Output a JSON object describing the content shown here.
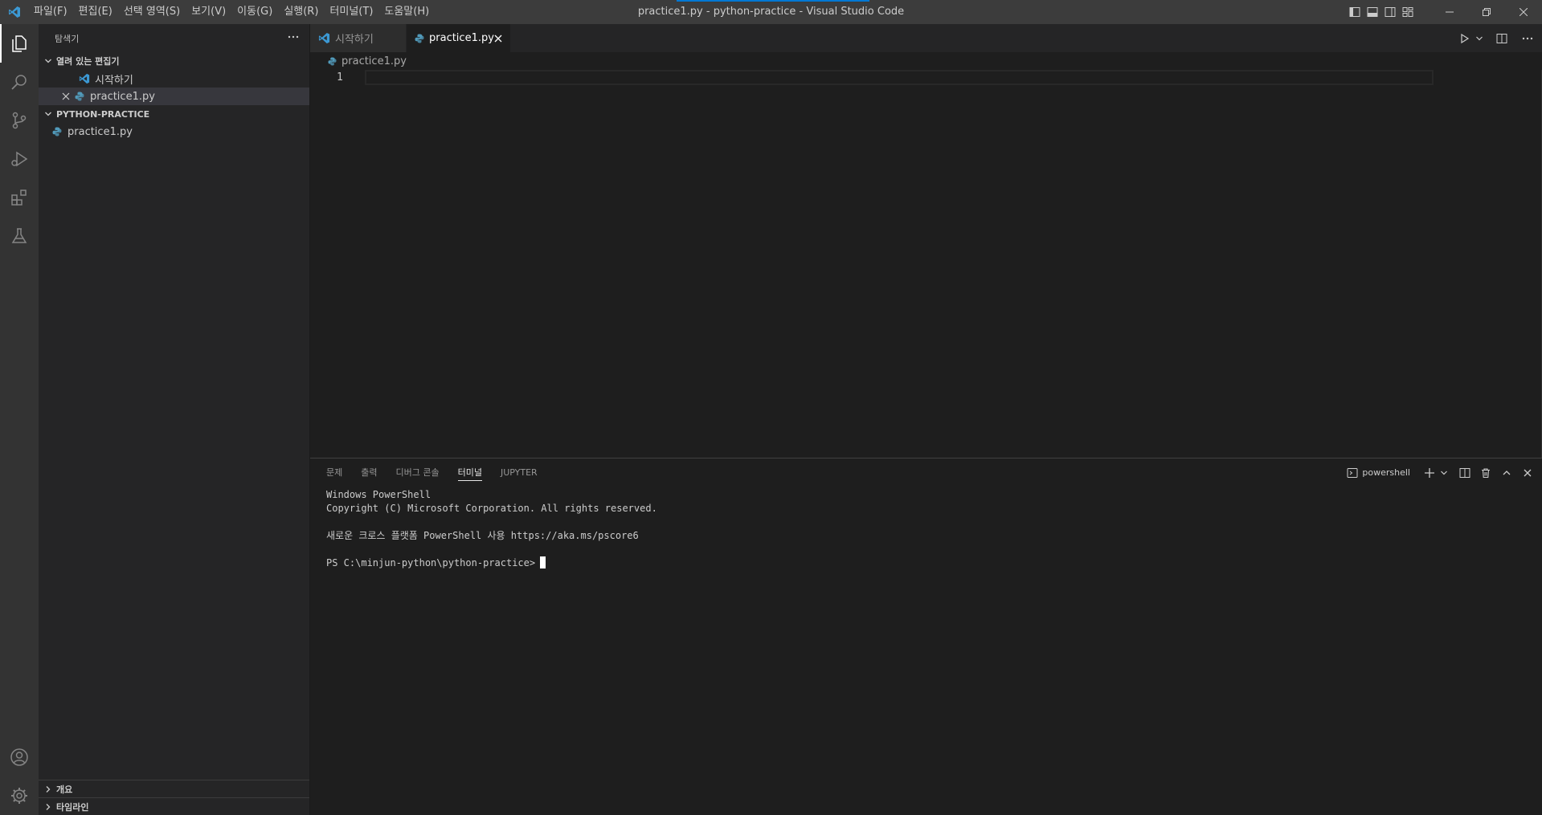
{
  "titlebar": {
    "window_title": "practice1.py - python-practice - Visual Studio Code",
    "menu": [
      "파일(F)",
      "편집(E)",
      "선택 영역(S)",
      "보기(V)",
      "이동(G)",
      "실행(R)",
      "터미널(T)",
      "도움말(H)"
    ]
  },
  "activitybar": {
    "items": [
      "files-icon",
      "search-icon",
      "source-control-icon",
      "run-debug-icon",
      "extensions-icon",
      "testing-icon"
    ],
    "bottom_items": [
      "account-icon",
      "settings-gear-icon"
    ]
  },
  "sidebar": {
    "title": "탐색기",
    "open_editors": {
      "label": "열려 있는 편집기",
      "items": [
        {
          "label": "시작하기",
          "icon": "vscode-icon"
        },
        {
          "label": "practice1.py",
          "icon": "python-icon"
        }
      ]
    },
    "folder": {
      "label": "PYTHON-PRACTICE",
      "files": [
        {
          "label": "practice1.py",
          "icon": "python-icon"
        }
      ]
    },
    "outline_label": "개요",
    "timeline_label": "타임라인"
  },
  "editor": {
    "tabs": [
      {
        "label": "시작하기",
        "active": false
      },
      {
        "label": "practice1.py",
        "active": true
      }
    ],
    "breadcrumb": "practice1.py",
    "line_numbers": [
      "1"
    ]
  },
  "panel": {
    "tabs": [
      "문제",
      "출력",
      "디버그 콘솔",
      "터미널",
      "JUPYTER"
    ],
    "active_tab": "터미널",
    "shell_name": "powershell",
    "terminal_lines": [
      "Windows PowerShell",
      "Copyright (C) Microsoft Corporation. All rights reserved.",
      "",
      "새로운 크로스 플랫폼 PowerShell 사용 https://aka.ms/pscore6",
      "",
      "PS C:\\minjun-python\\python-practice>"
    ]
  },
  "colors": {
    "titlebar": "#3c3c3c",
    "activitybar": "#333333",
    "sidebar": "#252526",
    "editor": "#1e1e1e",
    "accent": "#0078d4",
    "vscode_blue": "#3c99d4",
    "python_blue": "#519aba"
  }
}
